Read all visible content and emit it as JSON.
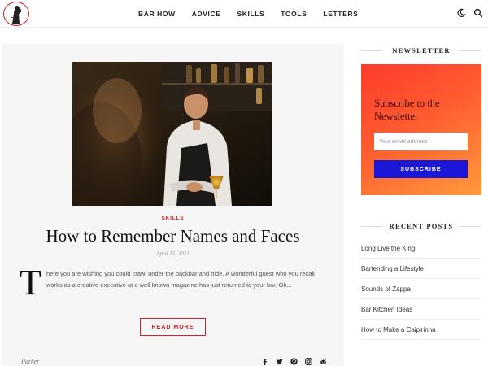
{
  "nav": {
    "items": [
      "BAR HOW",
      "ADVICE",
      "SKILLS",
      "TOOLS",
      "LETTERS"
    ],
    "icons": [
      "moon-icon",
      "search-icon"
    ]
  },
  "post": {
    "category": "SKILLS",
    "title": "How to Remember Names and Faces",
    "date": "April 15, 2021",
    "dropcap": "T",
    "excerpt": "here you are wishing you could crawl under the backbar and hide.  A wonderful guest who you recall works as a creative executive at a well known magazine has just returned to your bar.  Oh...",
    "read_more": "READ MORE",
    "author": "Parker",
    "share_icons": [
      "facebook-icon",
      "twitter-icon",
      "pinterest-icon",
      "instagram-icon",
      "reddit-icon"
    ]
  },
  "sidebar": {
    "newsletter": {
      "heading": "NEWSLETTER",
      "title": "Subscribe to the Newsletter",
      "placeholder": "Your email address",
      "button": "SUBSCRIBE"
    },
    "recent_posts": {
      "heading": "RECENT POSTS",
      "items": [
        "Long Live the King",
        "Bartending a Lifestyle",
        "Sounds of Zappa",
        "Bar Kitchen Ideas",
        "How to Make a Caipirinha"
      ]
    }
  },
  "colors": {
    "accent": "#c9242a",
    "newsletter_gradient": [
      "#ff3b2d",
      "#ff9a3d"
    ],
    "subscribe_button": "#1b17d8",
    "card_background": "#f6f6f6"
  }
}
